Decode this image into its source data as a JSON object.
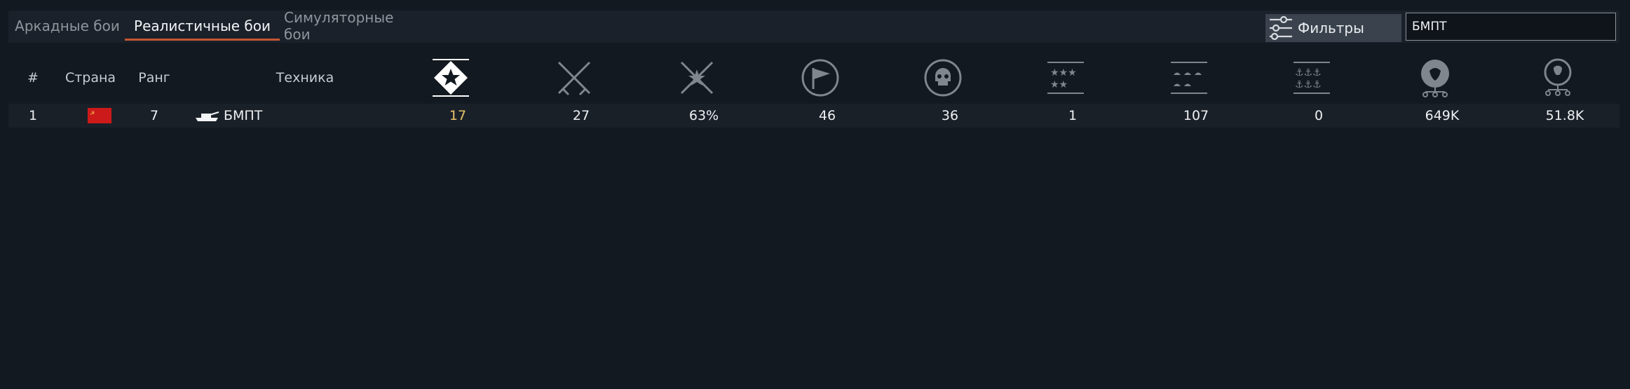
{
  "tabs": [
    {
      "label": "Аркадные бои",
      "active": false
    },
    {
      "label": "Реалистичные бои",
      "active": true
    },
    {
      "label": "Симуляторные бои",
      "active": false
    }
  ],
  "filter": {
    "label": "Фильтры",
    "icon": "sliders-icon"
  },
  "search": {
    "value": "БМПТ"
  },
  "columns": {
    "number": "#",
    "country": "Страна",
    "rank": "Ранг",
    "vehicle": "Техника"
  },
  "stat_icons": [
    "vehicle-rating-icon",
    "crossed-swords-icon",
    "crossed-swords-star-icon",
    "capture-flag-icon",
    "skull-icon",
    "air-kills-stars-icon",
    "ground-kills-icon",
    "naval-kills-anchors-icon",
    "lion-icon",
    "research-bulb-icon"
  ],
  "rows": [
    {
      "number": "1",
      "country_flag": "ussr-flag-icon",
      "rank": "7",
      "vehicle_icon": "tank-icon",
      "vehicle": "БМПТ",
      "stats": [
        "17",
        "27",
        "63%",
        "46",
        "36",
        "1",
        "107",
        "0",
        "649K",
        "51.8K"
      ]
    }
  ],
  "colors": {
    "background": "#131921",
    "accent_underline": "#c65634",
    "highlight_value": "#e9c46a",
    "flag_red": "#cc1a1a"
  }
}
